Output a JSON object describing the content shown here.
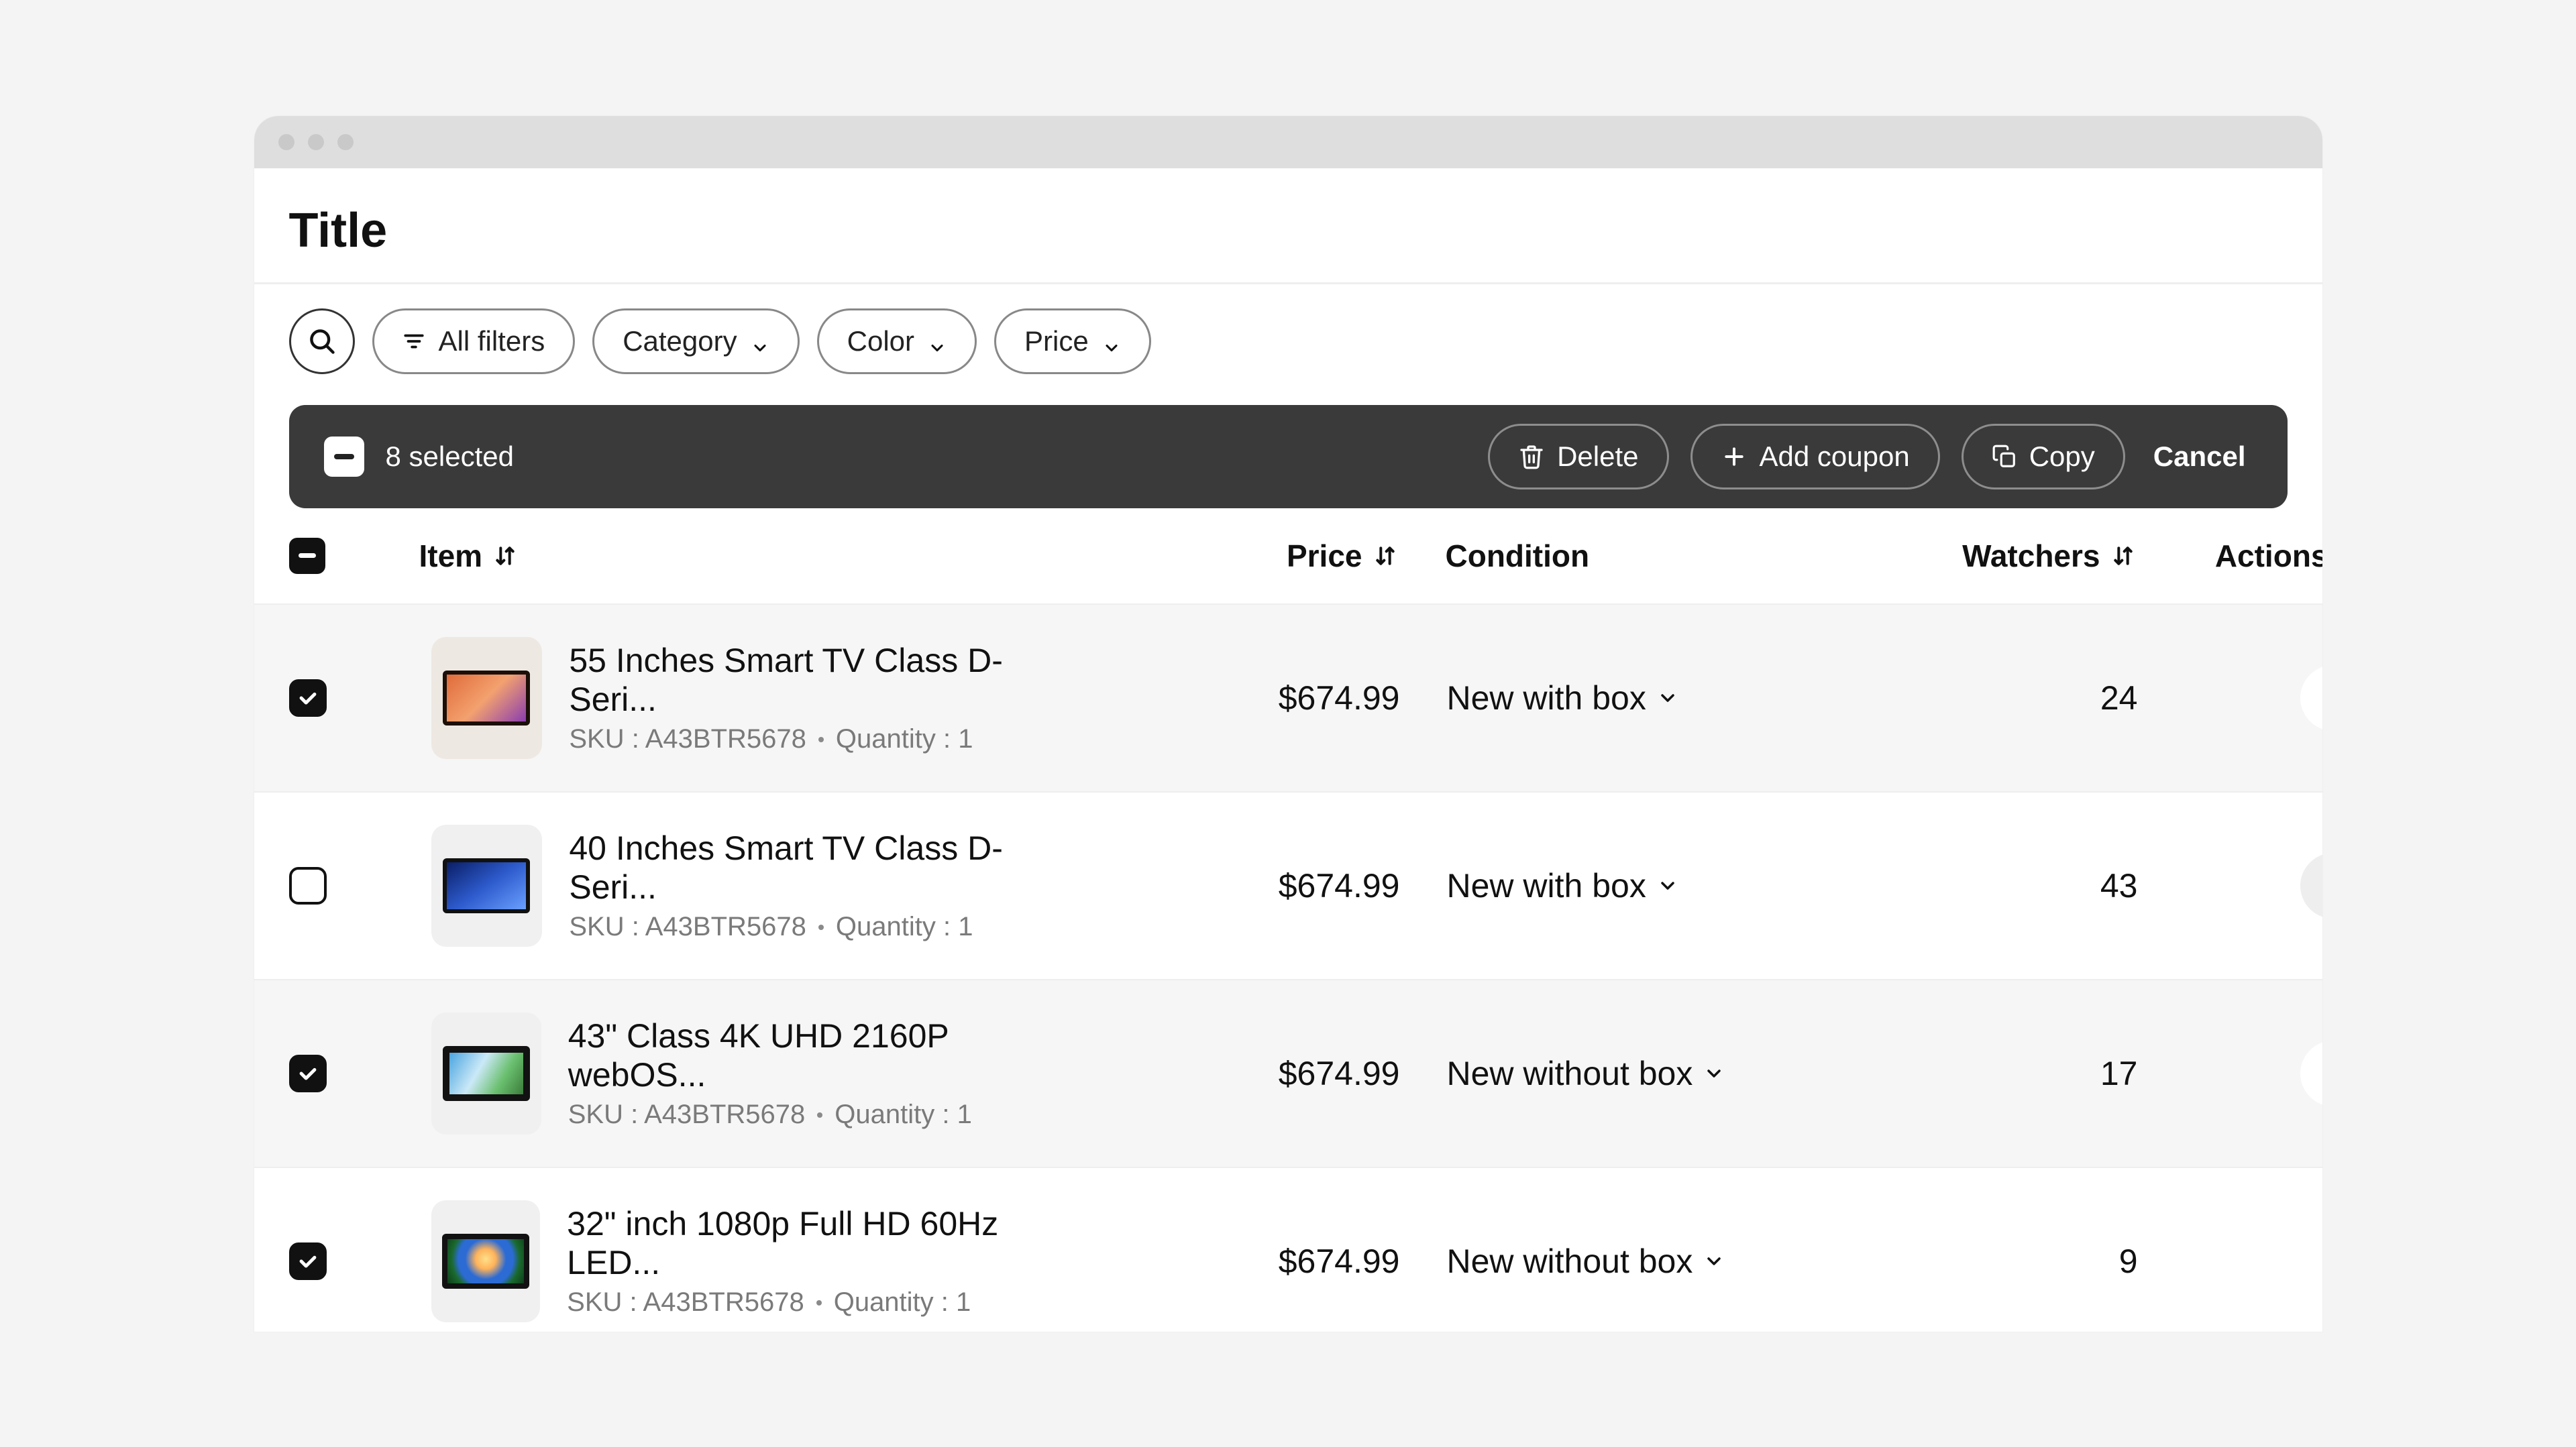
{
  "page_title": "Title",
  "filters": {
    "all": "All filters",
    "category": "Category",
    "color": "Color",
    "price": "Price"
  },
  "selection_bar": {
    "count_text": "8 selected",
    "delete": "Delete",
    "add_coupon": "Add coupon",
    "copy": "Copy",
    "cancel": "Cancel"
  },
  "columns": {
    "item": "Item",
    "price": "Price",
    "condition": "Condition",
    "watchers": "Watchers",
    "actions": "Actions"
  },
  "rows": [
    {
      "selected": true,
      "name": "55 Inches Smart TV Class D-Seri...",
      "sku_label": "SKU : A43BTR5678",
      "qty_label": "Quantity : 1",
      "price": "$674.99",
      "condition": "New with box",
      "watchers": "24"
    },
    {
      "selected": false,
      "name": "40 Inches Smart TV Class D-Seri...",
      "sku_label": "SKU : A43BTR5678",
      "qty_label": "Quantity : 1",
      "price": "$674.99",
      "condition": "New with box",
      "watchers": "43"
    },
    {
      "selected": true,
      "name": "43\" Class 4K UHD 2160P webOS...",
      "sku_label": "SKU : A43BTR5678",
      "qty_label": "Quantity : 1",
      "price": "$674.99",
      "condition": "New without box",
      "watchers": "17"
    },
    {
      "selected": true,
      "name": "32\" inch 1080p Full HD 60Hz LED...",
      "sku_label": "SKU : A43BTR5678",
      "qty_label": "Quantity : 1",
      "price": "$674.99",
      "condition": "New without box",
      "watchers": "9"
    }
  ]
}
